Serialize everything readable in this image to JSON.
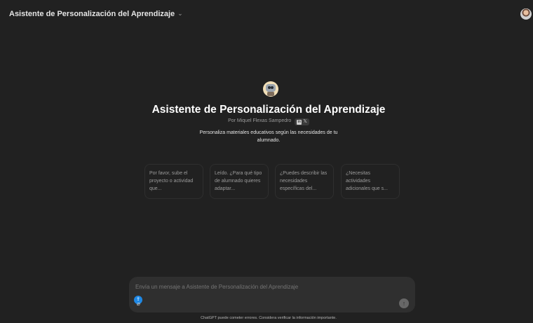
{
  "header": {
    "model_title": "Asistente de Personalización del Aprendizaje",
    "chevron": "⌄"
  },
  "gpt": {
    "name": "Asistente de Personalización del Aprendizaje",
    "author": "Por Miquel Flexas Sampedro",
    "social_linkedin": "in",
    "social_x": "𝕏",
    "description": "Personaliza materiales educativos según las necesidades de tu alumnado."
  },
  "starters": [
    {
      "text": "Por favor, sube el proyecto o actividad que..."
    },
    {
      "text": "Leído. ¿Para qué tipo de alumnado quieres adaptar..."
    },
    {
      "text": "¿Puedes describir las necesidades específicas del..."
    },
    {
      "text": "¿Necesitas actividades adicionales que s..."
    }
  ],
  "composer": {
    "placeholder": "Envía un mensaje a Asistente de Personalización del Aprendizaje",
    "attach_icon": "paperclip-icon",
    "send_icon": "arrow-up-icon"
  },
  "footer": {
    "disclaimer": "ChatGPT puede cometer errores. Considera verificar la información importante."
  },
  "colors": {
    "background": "#212121",
    "composer": "#2f2f2f",
    "badge_blue": "#1e88e5"
  }
}
